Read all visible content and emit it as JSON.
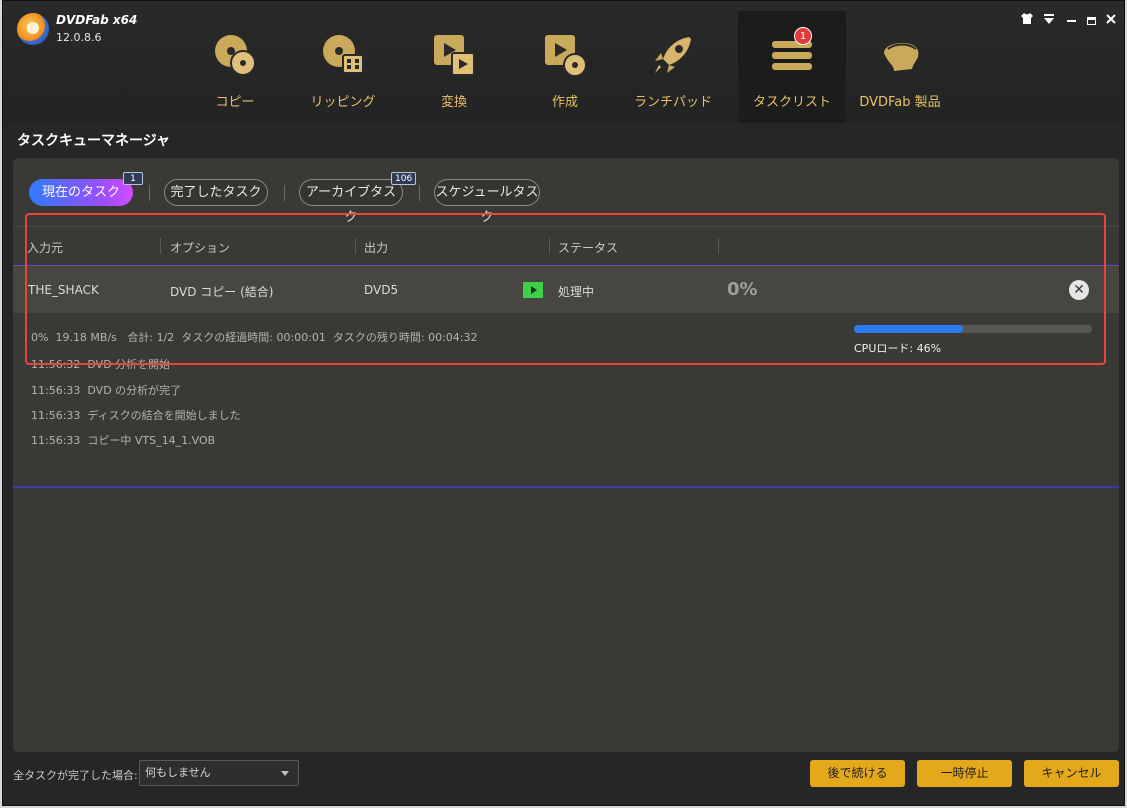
{
  "app": {
    "name": "DVDFab x64",
    "version": "12.0.8.6"
  },
  "nav": [
    {
      "label": "コピー",
      "icon": "copy-disc-icon"
    },
    {
      "label": "リッピング",
      "icon": "ripper-disc-icon"
    },
    {
      "label": "変換",
      "icon": "convert-film-icon"
    },
    {
      "label": "作成",
      "icon": "creator-film-icon"
    },
    {
      "label": "ランチパッド",
      "icon": "rocket-icon"
    },
    {
      "label": "タスクリスト",
      "icon": "task-list-icon",
      "badge": "1",
      "active": true
    },
    {
      "label": "DVDFab 製品",
      "icon": "products-icon"
    }
  ],
  "section_title": "タスクキューマネージャ",
  "tabs": [
    {
      "label": "現在のタスク",
      "badge": "1",
      "active": true
    },
    {
      "label": "完了したタスク"
    },
    {
      "label": "アーカイブタスク",
      "badge": "106"
    },
    {
      "label": "スケジュールタスク"
    }
  ],
  "table": {
    "headers": [
      "入力元",
      "オプション",
      "出力",
      "ステータス"
    ],
    "row": {
      "source": "THE_SHACK",
      "option": "DVD コピー (結合)",
      "output": "DVD5",
      "status": "処理中",
      "percent": "0%"
    }
  },
  "stats": "0%  19.18 MB/s   合計: 1/2  タスクの経過時間: 00:00:01  タスクの残り時間: 00:04:32",
  "progress": {
    "fraction": 0.46
  },
  "cpu": "CPUロード: 46%",
  "log": [
    "11:56:32  DVD 分析を開始",
    "11:56:33  DVD の分析が完了",
    "11:56:33  ディスクの結合を開始しました",
    "11:56:33  コピー中 VTS_14_1.VOB"
  ],
  "footer": {
    "after_label": "全タスクが完了した場合:",
    "after_value": "何もしません",
    "buttons": {
      "later": "後で続ける",
      "pause": "一時停止",
      "cancel": "キャンセル"
    }
  },
  "colors": {
    "accent_gold": "#e3a91a",
    "progress_blue": "#2a7bf4",
    "highlight_red": "#e8453c",
    "play_green": "#3fcf4a"
  }
}
